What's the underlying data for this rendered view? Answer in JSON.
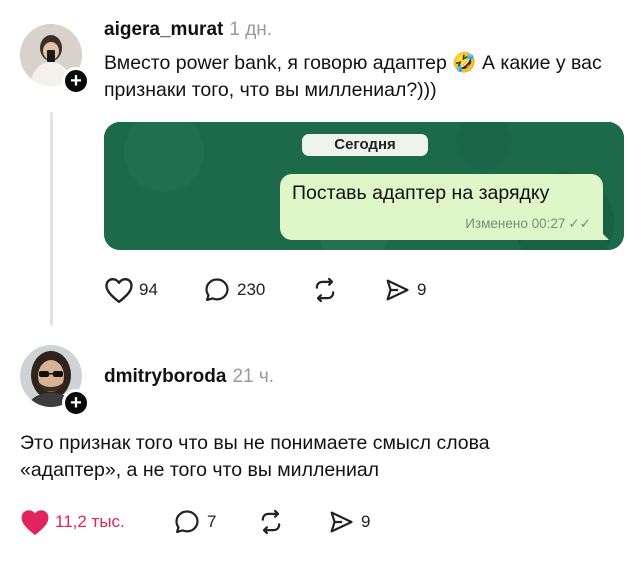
{
  "posts": [
    {
      "username": "aigera_murat",
      "time": "1 дн.",
      "text_part1": "Вместо power bank, я говорю адаптер ",
      "emoji": "🤣",
      "text_part2": " А какие у вас признаки того, что вы миллениал?)))",
      "media": {
        "date_label": "Сегодня",
        "message": "Поставь адаптер на зарядку",
        "edited_label": "Изменено 00:27"
      },
      "likes": "94",
      "replies": "230",
      "shares": "9",
      "liked": false
    },
    {
      "username": "dmitryboroda",
      "time": "21 ч.",
      "text": "Это признак того что вы не понимаете смысл слова «адаптер», а не того что вы миллениал",
      "likes": "11,2 тыс.",
      "replies": "7",
      "shares": "9",
      "liked": true
    }
  ],
  "colors": {
    "like_active": "#e0245e",
    "bubble": "#dff6c9",
    "media_bg": "#1d6a4b"
  }
}
